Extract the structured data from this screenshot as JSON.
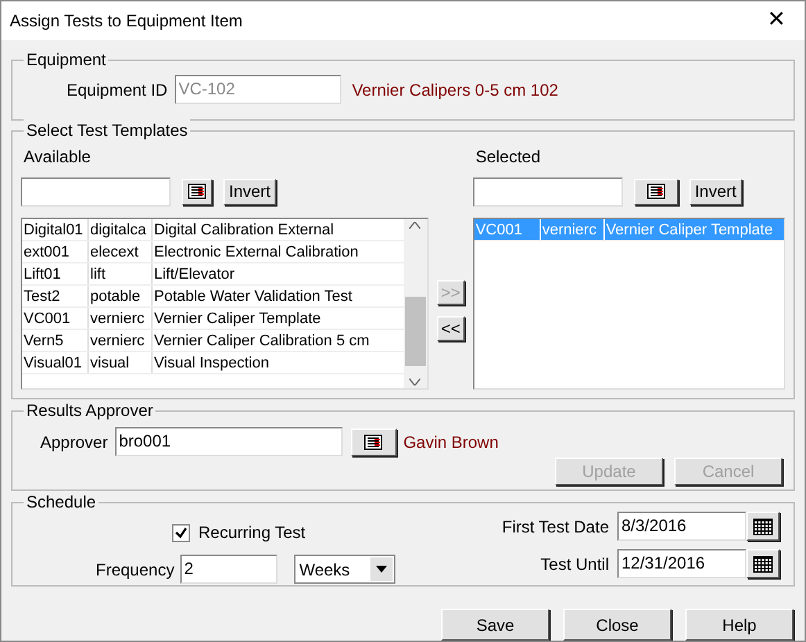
{
  "window": {
    "title": "Assign Tests to Equipment Item",
    "close": "✕"
  },
  "equipment": {
    "legend": "Equipment",
    "label": "Equipment ID",
    "value": "VC-102",
    "description": "Vernier Calipers 0-5 cm 102"
  },
  "templates": {
    "legend": "Select Test Templates",
    "available": {
      "label": "Available",
      "invert": "Invert",
      "rows": [
        {
          "cells": [
            "Digital01",
            "digitalca",
            "Digital Calibration External"
          ],
          "selected": false
        },
        {
          "cells": [
            "ext001",
            "elecext",
            "Electronic External Calibration"
          ],
          "selected": false
        },
        {
          "cells": [
            "Lift01",
            "lift",
            "Lift/Elevator"
          ],
          "selected": false
        },
        {
          "cells": [
            "Test2",
            "potable",
            "Potable Water Validation Test"
          ],
          "selected": false
        },
        {
          "cells": [
            "VC001",
            "vernierc",
            "Vernier Caliper Template"
          ],
          "selected": false
        },
        {
          "cells": [
            "Vern5",
            "vernierc",
            "Vernier Caliper Calibration 5 cm"
          ],
          "selected": false
        },
        {
          "cells": [
            "Visual01",
            "visual",
            "Visual Inspection"
          ],
          "selected": false
        }
      ]
    },
    "add": {
      "label": ">>",
      "disabled": true
    },
    "remove": {
      "label": "<<",
      "disabled": false
    },
    "selected": {
      "label": "Selected",
      "invert": "Invert",
      "rows": [
        {
          "cells": [
            "VC001",
            "vernierc",
            "Vernier Caliper Template"
          ],
          "selected": true
        }
      ]
    }
  },
  "approver": {
    "legend": "Results Approver",
    "label": "Approver",
    "value": "bro001",
    "name": "Gavin Brown",
    "buttons": [
      {
        "label": "Update",
        "disabled": true
      },
      {
        "label": "Cancel",
        "disabled": true
      }
    ]
  },
  "schedule": {
    "legend": "Schedule",
    "recurring": {
      "label": "Recurring Test",
      "checked": true
    },
    "frequency": {
      "label": "Frequency",
      "value": "2",
      "unit": "Weeks"
    },
    "first_date": {
      "label": "First Test Date",
      "value": "8/3/2016"
    },
    "until": {
      "label": "Test Until",
      "value": "12/31/2016"
    }
  },
  "buttons": [
    {
      "label": "Save"
    },
    {
      "label": "Close"
    },
    {
      "label": "Help"
    }
  ]
}
